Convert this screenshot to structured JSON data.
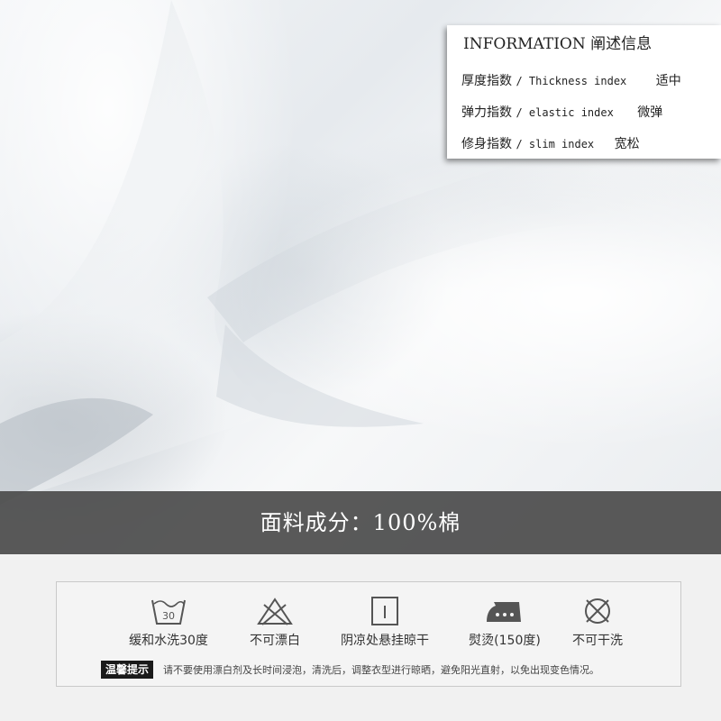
{
  "info": {
    "title": "INFORMATION 阐述信息",
    "rows": [
      {
        "label_cn": "厚度指数",
        "label_en": "/ Thickness index",
        "value": "适中"
      },
      {
        "label_cn": "弹力指数",
        "label_en": "/ elastic index",
        "value": "微弹"
      },
      {
        "label_cn": "修身指数",
        "label_en": "/ slim index",
        "value": "宽松"
      }
    ]
  },
  "composition": "面料成分：100%棉",
  "care": {
    "items": [
      {
        "icon": "wash-30-icon",
        "label": "缓和水洗30度",
        "temp": "30"
      },
      {
        "icon": "no-bleach-icon",
        "label": "不可漂白"
      },
      {
        "icon": "line-dry-shade-icon",
        "label": "阴凉处悬挂晾干"
      },
      {
        "icon": "iron-icon",
        "label": "熨烫(150度)"
      },
      {
        "icon": "no-dry-clean-icon",
        "label": "不可干洗"
      }
    ],
    "tip_badge": "温馨提示",
    "tip_text": "请不要使用漂白剂及长时间浸泡，清洗后，调整衣型进行晾晒，避免阳光直射，以免出现变色情况。"
  }
}
